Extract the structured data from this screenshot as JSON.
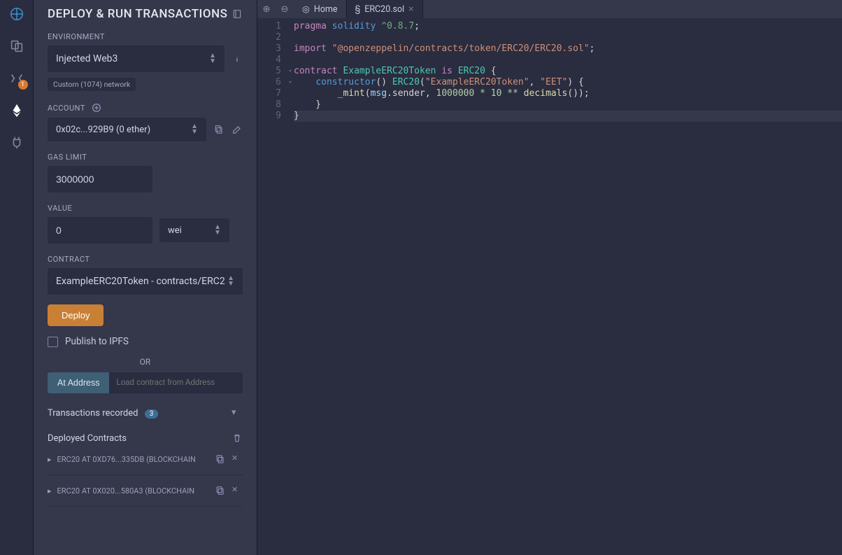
{
  "iconbar": {
    "compile_badge": "1"
  },
  "panel": {
    "title": "DEPLOY & RUN TRANSACTIONS",
    "env_label": "ENVIRONMENT",
    "env_value": "Injected Web3",
    "env_hint": "Custom (1074) network",
    "account_label": "ACCOUNT",
    "account_value": "0x02c...929B9 (0 ether)",
    "gas_label": "GAS LIMIT",
    "gas_value": "3000000",
    "value_label": "VALUE",
    "value_value": "0",
    "value_unit": "wei",
    "contract_label": "CONTRACT",
    "contract_value": "ExampleERC20Token - contracts/ERC2",
    "deploy_btn": "Deploy",
    "publish_ipfs": "Publish to IPFS",
    "or_text": "OR",
    "at_address_btn": "At Address",
    "at_address_placeholder": "Load contract from Address",
    "tx_recorded": "Transactions recorded",
    "tx_count": "3",
    "deployed_contracts": "Deployed Contracts",
    "deployed": [
      "ERC20 AT 0XD76...335DB (BLOCKCHAIN",
      "ERC20 AT 0X020...580A3 (BLOCKCHAIN"
    ]
  },
  "tabs": {
    "home": "Home",
    "file": "ERC20.sol"
  },
  "code": {
    "lines": [
      "1",
      "2",
      "3",
      "4",
      "5",
      "6",
      "7",
      "8",
      "9"
    ],
    "folds": [
      "",
      "",
      "",
      "",
      "▾",
      "▾",
      "",
      "",
      ""
    ],
    "l1": {
      "pragma": "pragma",
      "solidity": "solidity",
      "ver": "^0.8.7",
      "semi": ";"
    },
    "l3": {
      "import": "import",
      "str": "\"@openzeppelin/contracts/token/ERC20/ERC20.sol\"",
      "semi": ";"
    },
    "l5": {
      "contract": "contract",
      "name": "ExampleERC20Token",
      "is": "is",
      "base": "ERC20",
      "brace": "{"
    },
    "l6": {
      "ctor": "constructor",
      "par": "()",
      "erc": "ERC20",
      "args": "(\"ExampleERC20Token\", \"EET\")",
      "brace": " {",
      "s1": "\"ExampleERC20Token\"",
      "c": ", ",
      "s2": "\"EET\""
    },
    "l7": {
      "mint": "_mint",
      "msg": "msg",
      "sender": ".sender",
      "mid": ", ",
      "num": "1000000 * 10 **",
      "dec": " decimals",
      "tail": "());"
    },
    "l8": "    }",
    "l9": "}"
  }
}
